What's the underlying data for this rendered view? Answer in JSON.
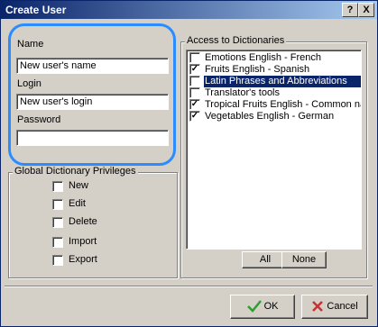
{
  "window": {
    "title": "Create User",
    "help_button": "?",
    "close_button": "X"
  },
  "form": {
    "name_label": "Name",
    "name_value": "New user's name",
    "login_label": "Login",
    "login_value": "New user's login",
    "password_label": "Password",
    "password_value": ""
  },
  "privileges": {
    "title": "Global Dictionary Privileges",
    "items": [
      {
        "label": "New",
        "checked": false
      },
      {
        "label": "Edit",
        "checked": false
      },
      {
        "label": "Delete",
        "checked": false
      },
      {
        "label": "Import",
        "checked": false
      },
      {
        "label": "Export",
        "checked": false
      }
    ]
  },
  "dictionaries": {
    "title": "Access to Dictionaries",
    "items": [
      {
        "label": "Emotions English - French",
        "checked": false,
        "selected": false
      },
      {
        "label": "Fruits English - Spanish",
        "checked": true,
        "selected": false
      },
      {
        "label": "Latin Phrases and Abbreviations",
        "checked": false,
        "selected": true
      },
      {
        "label": "Translator's tools",
        "checked": false,
        "selected": false
      },
      {
        "label": "Tropical Fruits English - Common names",
        "checked": true,
        "selected": false
      },
      {
        "label": "Vegetables English - German",
        "checked": true,
        "selected": false
      }
    ],
    "all_button": "All",
    "none_button": "None"
  },
  "footer": {
    "ok_button": "OK",
    "cancel_button": "Cancel"
  },
  "colors": {
    "accent_highlight": "#2a8cff",
    "selection": "#0a246a",
    "ok_check": "#2e9e2e",
    "cancel_x": "#c83232"
  }
}
